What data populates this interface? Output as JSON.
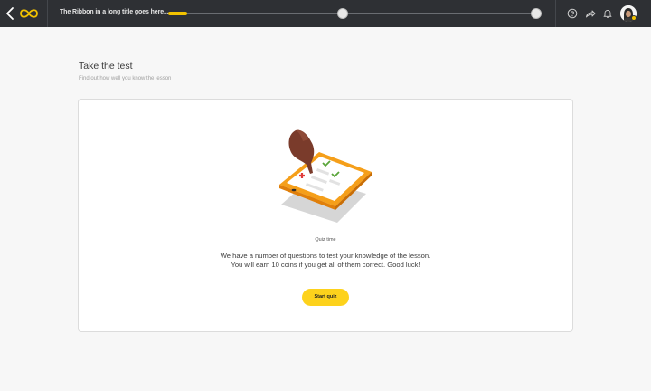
{
  "app": {
    "lesson_title": "The Ribbon in a long title goes here...",
    "progress": 0.05,
    "accent_color": "#fdd21c",
    "icons": [
      "chevron-left-icon",
      "infinity-logo-icon",
      "help-icon",
      "share-icon",
      "bell-icon",
      "avatar"
    ]
  },
  "page": {
    "title": "Take the test",
    "subtitle": "Find out how well you know the lesson"
  },
  "quiz": {
    "label": "Quiz time",
    "description": "We have a number of questions to test your knowledge of the lesson. You will earn 10 coins if you get all of them correct. Good luck!",
    "button_label": "Start quiz"
  }
}
